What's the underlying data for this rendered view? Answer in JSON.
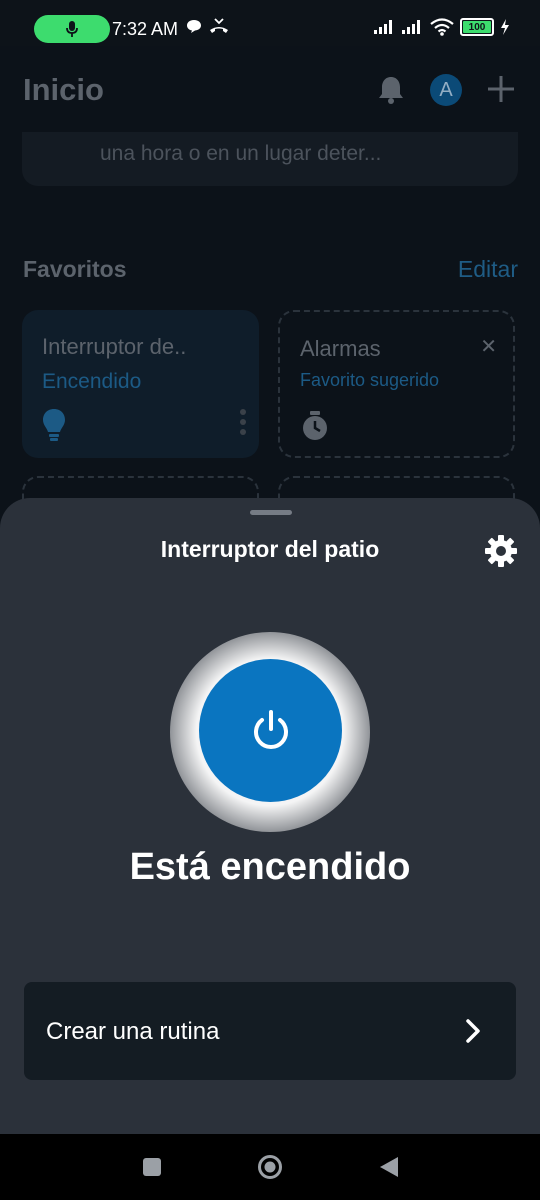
{
  "status_bar": {
    "time": "7:32 AM",
    "battery": "100"
  },
  "header": {
    "title": "Inicio",
    "avatar_initial": "A"
  },
  "hint_card": {
    "text": "una hora o en un lugar deter..."
  },
  "favorites": {
    "title": "Favoritos",
    "edit_label": "Editar",
    "cards": [
      {
        "title": "Interruptor de..",
        "subtitle": "Encendido",
        "icon": "lightbulb-icon"
      },
      {
        "title": "Alarmas",
        "subtitle": "Favorito sugerido",
        "icon": "alarm-clock-icon"
      }
    ]
  },
  "sheet": {
    "title": "Interruptor del patio",
    "state_text": "Está encendido",
    "routine_label": "Crear una rutina",
    "accent_color": "#0a75c0"
  },
  "icons": {
    "status_left": [
      "mic-icon",
      "chat-bubble-icon",
      "missed-call-icon"
    ],
    "status_right": [
      "signal-icon",
      "signal-icon",
      "wifi-icon",
      "battery-icon",
      "charging-icon"
    ],
    "header": [
      "bell-icon",
      "plus-icon"
    ],
    "sheet": [
      "gear-icon",
      "power-icon",
      "chevron-right-icon"
    ],
    "nav": [
      "square-icon",
      "circle-icon",
      "triangle-back-icon"
    ]
  }
}
